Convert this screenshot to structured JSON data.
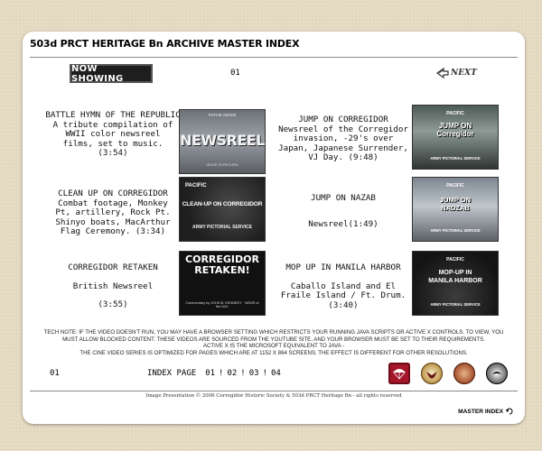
{
  "header": {
    "title": "503d PRCT HERITAGE Bn ARCHIVE MASTER INDEX"
  },
  "now_showing": {
    "label": "NOW SHOWING",
    "page_number": "01"
  },
  "nav": {
    "next_label": "NEXT",
    "master_index_label": "MASTER INDEX"
  },
  "videos": [
    {
      "title": "BATTLE HYMN OF THE REPUBLIC",
      "lines": [
        "A tribute compilation of",
        "WWII color newsreel",
        "films, set to music."
      ],
      "duration": "(3:54)",
      "thumb_top": "PATHE NEWS",
      "thumb_main": "NEWSREEL",
      "thumb_bottom": "ISSUE 23 RETURN"
    },
    {
      "title": "JUMP ON CORREGIDOR",
      "lines": [
        "Newsreel of the Corregidor",
        "invasion, -29's over",
        "Japan, Japanese Surrender,"
      ],
      "duration": "VJ Day. (9:48)",
      "thumb_top": "PACIFIC",
      "thumb_main": "JUMP ON\nCorregidor",
      "thumb_bottom": "ARMY PICTORIAL SERVICE"
    },
    {
      "title": "CLEAN UP ON CORREGIDOR",
      "lines": [
        "Combat footage, Monkey",
        "Pt, artillery, Rock Pt.",
        "Shinyo boats, MacArthur"
      ],
      "duration": "Flag Ceremony. (3:34)",
      "thumb_top": "PACIFIC",
      "thumb_main": "CLEAN-UP ON CORREGIDOR",
      "thumb_bottom": "ARMY PICTORIAL SERVICE"
    },
    {
      "title": "JUMP ON NAZAB",
      "lines": [
        "Newsreel(1:49)"
      ],
      "duration": "",
      "thumb_top": "PACIFIC",
      "thumb_main": "JUMP ON\nNADZAB",
      "thumb_bottom": "ARMY PICTORIAL SERVICE"
    },
    {
      "title": "CORREGIDOR RETAKEN",
      "lines": [
        "British Newsreel"
      ],
      "duration": "(3:55)",
      "thumb_top": "",
      "thumb_main": "CORREGIDOR\nRETAKEN!",
      "thumb_bottom": "Commentary by JOHN B. KENNEDY · NEWS of the DAY"
    },
    {
      "title": "MOP UP IN MANILA HARBOR",
      "lines": [
        "Caballo Island and El",
        "Fraile Island / Ft. Drum."
      ],
      "duration": "(3:40)",
      "thumb_top": "PACIFIC",
      "thumb_main": "MOP-UP IN\nMANILA HARBOR",
      "thumb_bottom": "ARMY PICTORIAL SERVICE"
    }
  ],
  "tech_note": [
    "TECH NOTE:   IF THE VIDEO DOESN'T RUN, YOU MAY HAVE A BROWSER SETTING WHICH RESTRICTS YOUR RUNNING JAVA SCRIPTS OR ACTIVE X CONTROLS. TO VIEW, YOU",
    "MUST ALLOW BLOCKED CONTENT. THESE VIDEOS ARE SOURCED FROM THE YOUTUBE SITE, AND YOUR BROWSER MUST BE SET TO THEIR REQUIREMENTS.",
    "ACTIVE X IS THE MICROSOFT EQUIVALENT TO JAVA -",
    "THE CINE VIDEO SERIES IS OPTIMIZED FOR PAGES WHICH ARE AT 1152 X 864 SCREENS.   THE EFFECT IS DIFFERENT FOR OTHER RESOLUTIONS."
  ],
  "footer": {
    "page_number": "01",
    "index_label": "INDEX PAGE",
    "index_pages": [
      "01",
      "02",
      "03",
      "04"
    ],
    "separator": "!",
    "copyright": "Image Presentation  © 2006 Corregidor Historic Society & 503d PRCT Heritage Bn - all rights reserved"
  },
  "colors": {
    "background": "#e6dcc4",
    "panel": "#ffffff",
    "badge_red": "#a5162a"
  }
}
